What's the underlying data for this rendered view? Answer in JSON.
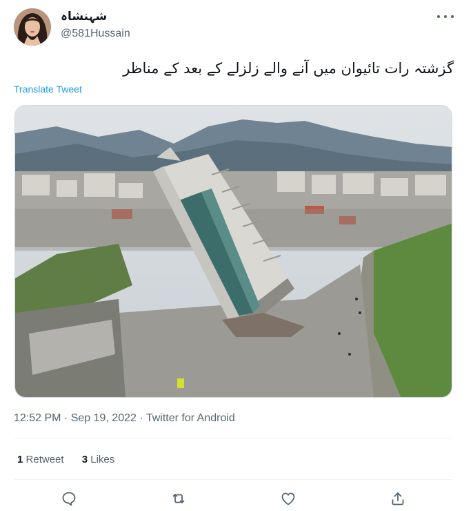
{
  "author": {
    "display_name": "شہنشاہ",
    "handle": "@581Hussain"
  },
  "tweet": {
    "text": "گزشتہ رات تائیوان میں آنے والے زلزلے کے بعد کے مناظر",
    "translate_label": "Translate Tweet"
  },
  "meta": {
    "time": "12:52 PM",
    "separator1": " · ",
    "date": "Sep 19, 2022",
    "separator2": " · ",
    "source": "Twitter for Android"
  },
  "stats": {
    "retweets_count": "1",
    "retweets_label": "Retweet",
    "likes_count": "3",
    "likes_label": "Likes"
  },
  "colors": {
    "link": "#1d9bf0",
    "secondary_text": "#536471",
    "primary_text": "#0f1419",
    "divider": "#eff3f4"
  },
  "icons": {
    "reply": "speech-bubble-icon",
    "retweet": "retweet-arrows-icon",
    "like": "heart-icon",
    "share": "share-upload-icon",
    "more": "more-horizontal-icon"
  }
}
